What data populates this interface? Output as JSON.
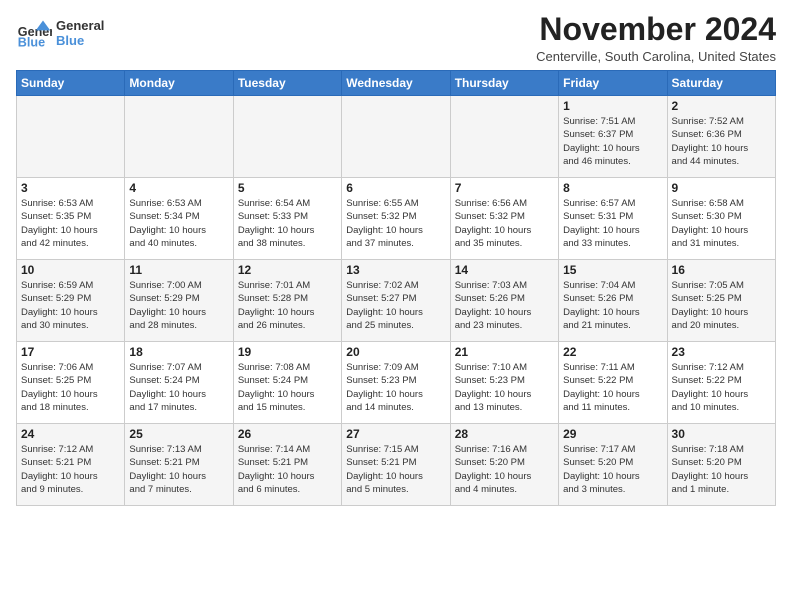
{
  "logo": {
    "line1": "General",
    "line2": "Blue"
  },
  "title": "November 2024",
  "subtitle": "Centerville, South Carolina, United States",
  "headers": [
    "Sunday",
    "Monday",
    "Tuesday",
    "Wednesday",
    "Thursday",
    "Friday",
    "Saturday"
  ],
  "weeks": [
    [
      {
        "day": "",
        "info": ""
      },
      {
        "day": "",
        "info": ""
      },
      {
        "day": "",
        "info": ""
      },
      {
        "day": "",
        "info": ""
      },
      {
        "day": "",
        "info": ""
      },
      {
        "day": "1",
        "info": "Sunrise: 7:51 AM\nSunset: 6:37 PM\nDaylight: 10 hours\nand 46 minutes."
      },
      {
        "day": "2",
        "info": "Sunrise: 7:52 AM\nSunset: 6:36 PM\nDaylight: 10 hours\nand 44 minutes."
      }
    ],
    [
      {
        "day": "3",
        "info": "Sunrise: 6:53 AM\nSunset: 5:35 PM\nDaylight: 10 hours\nand 42 minutes."
      },
      {
        "day": "4",
        "info": "Sunrise: 6:53 AM\nSunset: 5:34 PM\nDaylight: 10 hours\nand 40 minutes."
      },
      {
        "day": "5",
        "info": "Sunrise: 6:54 AM\nSunset: 5:33 PM\nDaylight: 10 hours\nand 38 minutes."
      },
      {
        "day": "6",
        "info": "Sunrise: 6:55 AM\nSunset: 5:32 PM\nDaylight: 10 hours\nand 37 minutes."
      },
      {
        "day": "7",
        "info": "Sunrise: 6:56 AM\nSunset: 5:32 PM\nDaylight: 10 hours\nand 35 minutes."
      },
      {
        "day": "8",
        "info": "Sunrise: 6:57 AM\nSunset: 5:31 PM\nDaylight: 10 hours\nand 33 minutes."
      },
      {
        "day": "9",
        "info": "Sunrise: 6:58 AM\nSunset: 5:30 PM\nDaylight: 10 hours\nand 31 minutes."
      }
    ],
    [
      {
        "day": "10",
        "info": "Sunrise: 6:59 AM\nSunset: 5:29 PM\nDaylight: 10 hours\nand 30 minutes."
      },
      {
        "day": "11",
        "info": "Sunrise: 7:00 AM\nSunset: 5:29 PM\nDaylight: 10 hours\nand 28 minutes."
      },
      {
        "day": "12",
        "info": "Sunrise: 7:01 AM\nSunset: 5:28 PM\nDaylight: 10 hours\nand 26 minutes."
      },
      {
        "day": "13",
        "info": "Sunrise: 7:02 AM\nSunset: 5:27 PM\nDaylight: 10 hours\nand 25 minutes."
      },
      {
        "day": "14",
        "info": "Sunrise: 7:03 AM\nSunset: 5:26 PM\nDaylight: 10 hours\nand 23 minutes."
      },
      {
        "day": "15",
        "info": "Sunrise: 7:04 AM\nSunset: 5:26 PM\nDaylight: 10 hours\nand 21 minutes."
      },
      {
        "day": "16",
        "info": "Sunrise: 7:05 AM\nSunset: 5:25 PM\nDaylight: 10 hours\nand 20 minutes."
      }
    ],
    [
      {
        "day": "17",
        "info": "Sunrise: 7:06 AM\nSunset: 5:25 PM\nDaylight: 10 hours\nand 18 minutes."
      },
      {
        "day": "18",
        "info": "Sunrise: 7:07 AM\nSunset: 5:24 PM\nDaylight: 10 hours\nand 17 minutes."
      },
      {
        "day": "19",
        "info": "Sunrise: 7:08 AM\nSunset: 5:24 PM\nDaylight: 10 hours\nand 15 minutes."
      },
      {
        "day": "20",
        "info": "Sunrise: 7:09 AM\nSunset: 5:23 PM\nDaylight: 10 hours\nand 14 minutes."
      },
      {
        "day": "21",
        "info": "Sunrise: 7:10 AM\nSunset: 5:23 PM\nDaylight: 10 hours\nand 13 minutes."
      },
      {
        "day": "22",
        "info": "Sunrise: 7:11 AM\nSunset: 5:22 PM\nDaylight: 10 hours\nand 11 minutes."
      },
      {
        "day": "23",
        "info": "Sunrise: 7:12 AM\nSunset: 5:22 PM\nDaylight: 10 hours\nand 10 minutes."
      }
    ],
    [
      {
        "day": "24",
        "info": "Sunrise: 7:12 AM\nSunset: 5:21 PM\nDaylight: 10 hours\nand 9 minutes."
      },
      {
        "day": "25",
        "info": "Sunrise: 7:13 AM\nSunset: 5:21 PM\nDaylight: 10 hours\nand 7 minutes."
      },
      {
        "day": "26",
        "info": "Sunrise: 7:14 AM\nSunset: 5:21 PM\nDaylight: 10 hours\nand 6 minutes."
      },
      {
        "day": "27",
        "info": "Sunrise: 7:15 AM\nSunset: 5:21 PM\nDaylight: 10 hours\nand 5 minutes."
      },
      {
        "day": "28",
        "info": "Sunrise: 7:16 AM\nSunset: 5:20 PM\nDaylight: 10 hours\nand 4 minutes."
      },
      {
        "day": "29",
        "info": "Sunrise: 7:17 AM\nSunset: 5:20 PM\nDaylight: 10 hours\nand 3 minutes."
      },
      {
        "day": "30",
        "info": "Sunrise: 7:18 AM\nSunset: 5:20 PM\nDaylight: 10 hours\nand 1 minute."
      }
    ]
  ]
}
